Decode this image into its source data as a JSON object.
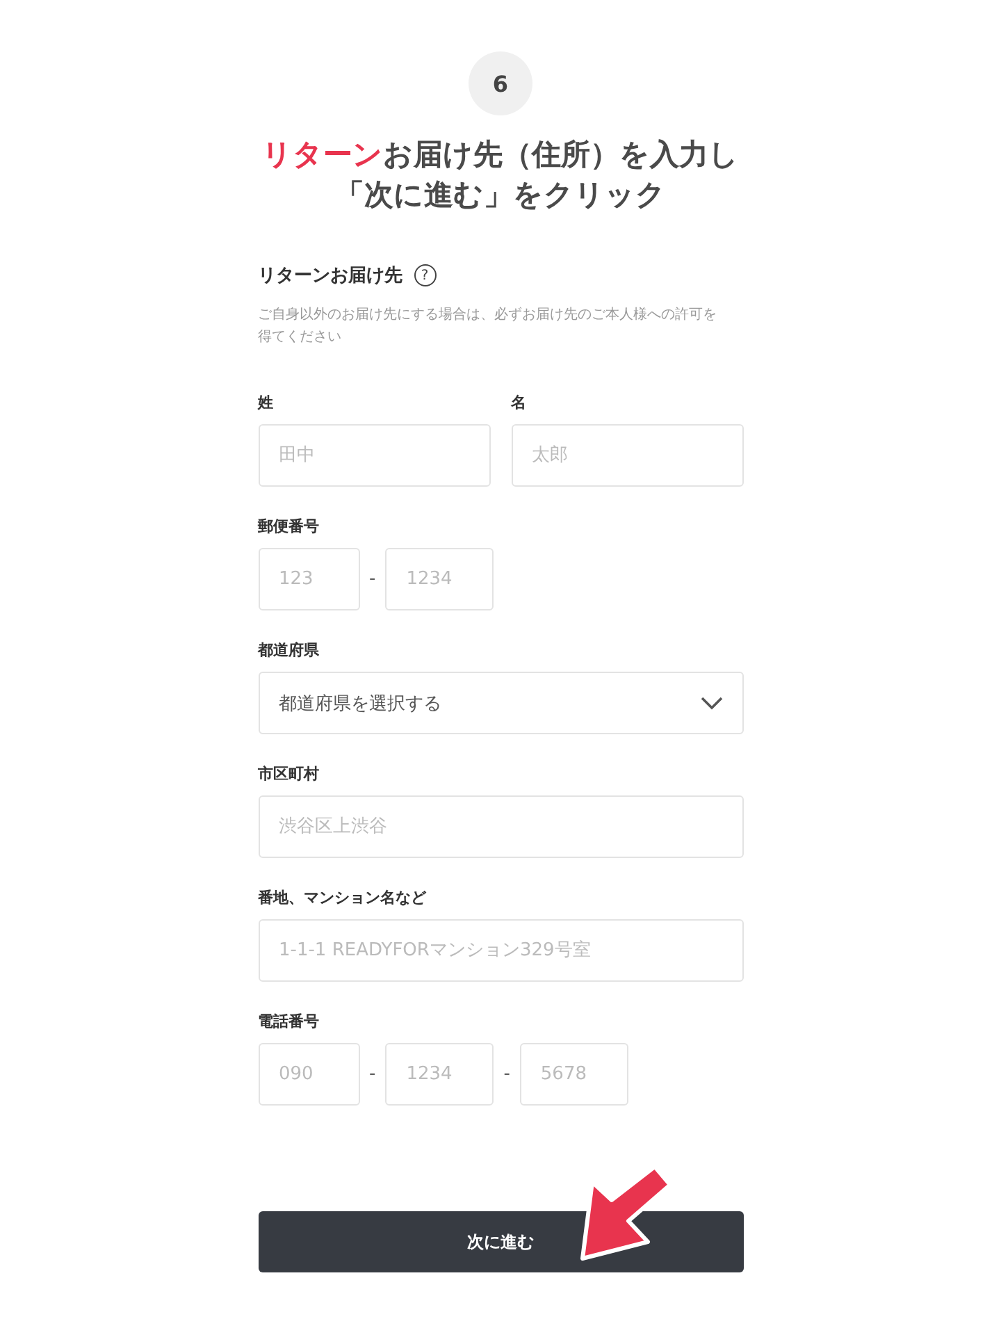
{
  "step": {
    "number": "6"
  },
  "heading": {
    "lines": [
      [
        {
          "text": "リターン",
          "highlight": true
        },
        {
          "text": "お届け先（住所）を入力し",
          "highlight": false
        }
      ],
      [
        {
          "text": "「次に進む」をクリック",
          "highlight": false
        }
      ]
    ]
  },
  "section": {
    "title": "リターンお届け先",
    "help_icon": "?",
    "note": "ご自身以外のお届け先にする場合は、必ずお届け先のご本人様への許可を得てください"
  },
  "rows": [
    {
      "kind": "columns",
      "columns": [
        {
          "label": "姓",
          "placeholder": "田中"
        },
        {
          "label": "名",
          "placeholder": "太郎"
        }
      ]
    },
    {
      "kind": "split",
      "label": "郵便番号",
      "separator": "-",
      "inputs": [
        {
          "placeholder": "123"
        },
        {
          "placeholder": "1234"
        }
      ]
    },
    {
      "kind": "select",
      "label": "都道府県",
      "value": "都道府県を選択する"
    },
    {
      "kind": "text",
      "label": "市区町村",
      "placeholder": "渋谷区上渋谷"
    },
    {
      "kind": "text",
      "label": "番地、マンション名など",
      "placeholder": "1-1-1 READYFORマンション329号室"
    },
    {
      "kind": "split",
      "label": "電話番号",
      "separator": "-",
      "inputs": [
        {
          "placeholder": "090"
        },
        {
          "placeholder": "1234"
        },
        {
          "placeholder": "5678"
        }
      ]
    }
  ],
  "submit_button": {
    "label": "次に進む"
  }
}
